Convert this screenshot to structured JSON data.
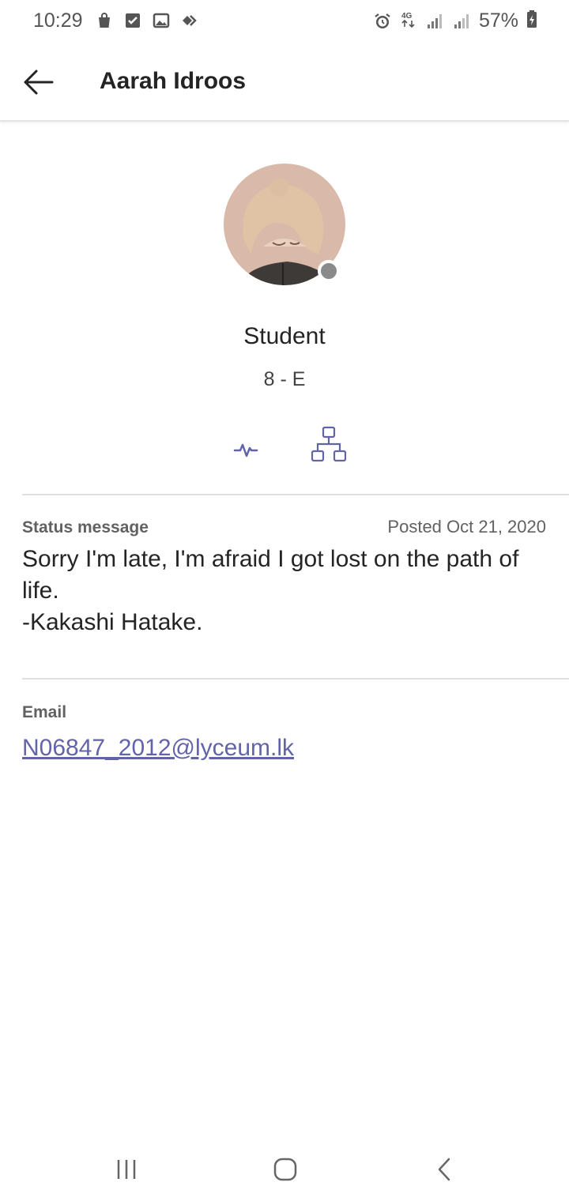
{
  "status_bar": {
    "time": "10:29",
    "battery": "57%",
    "network": "4G",
    "left_icons": [
      "shopping-bag-icon",
      "checkbox-icon",
      "image-icon",
      "tag-icon"
    ],
    "right_icons": [
      "alarm-icon",
      "network-4g-icon",
      "signal-icon",
      "signal-icon",
      "battery-icon"
    ]
  },
  "header": {
    "title": "Aarah Idroos",
    "back_icon": "arrow-left-icon"
  },
  "profile": {
    "role": "Student",
    "group": "8 - E",
    "presence_color": "#8a8a8a",
    "actions": [
      "activity-icon",
      "org-chart-icon"
    ]
  },
  "status": {
    "label": "Status message",
    "posted": "Posted Oct 21, 2020",
    "message": "Sorry I'm late, I'm afraid I got lost on the path of life.\n-Kakashi Hatake."
  },
  "email": {
    "label": "Email",
    "value": "N06847_2012@lyceum.lk"
  },
  "nav_bar": {
    "items": [
      "recent-apps-icon",
      "home-icon",
      "back-icon"
    ]
  },
  "colors": {
    "accent": "#6264a7",
    "text": "#242424",
    "secondary": "#616161",
    "divider": "#e0e0e0"
  }
}
